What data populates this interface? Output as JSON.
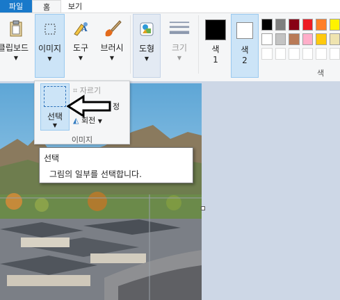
{
  "tabs": {
    "file": "파일",
    "home": "홈",
    "view": "보기"
  },
  "ribbon": {
    "clipboard": "클립보드",
    "image": "이미지",
    "tools": "도구",
    "brushes": "브러시",
    "shapes": "도형",
    "size": "크기",
    "color1_line1": "색",
    "color1_line2": "1",
    "color2_line1": "색",
    "color2_line2": "2",
    "colors_group": "색"
  },
  "colors": {
    "color1": "#000000",
    "color2": "#ffffff",
    "palette_row1": [
      "#000000",
      "#7f7f7f",
      "#880015",
      "#ed1c24",
      "#ff7f27",
      "#fff200"
    ],
    "palette_row2": [
      "#ffffff",
      "#c3c3c3",
      "#b97a57",
      "#ffaec9",
      "#ffc90e",
      "#efe4b0"
    ]
  },
  "image_menu": {
    "select": "선택",
    "crop": "자르기",
    "resize_suffix": "정",
    "rotate": "회전",
    "group": "이미지"
  },
  "tooltip": {
    "title": "선택",
    "body": "그림의 일부를 선택합니다."
  }
}
